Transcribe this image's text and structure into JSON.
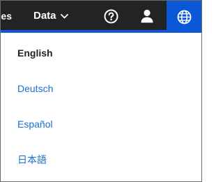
{
  "topbar": {
    "partial_nav_label": "es",
    "data_menu_label": "Data",
    "help_icon": "help-circle-icon",
    "user_icon": "user-icon",
    "language_icon": "globe-icon"
  },
  "language_menu": {
    "items": [
      {
        "label": "English",
        "selected": true
      },
      {
        "label": "Deutsch",
        "selected": false
      },
      {
        "label": "Español",
        "selected": false
      },
      {
        "label": "日本語",
        "selected": false
      }
    ]
  },
  "colors": {
    "topbar_background": "#222325",
    "accent": "#0a58d6",
    "link": "#1a6fd0",
    "selected_text": "#222325"
  }
}
